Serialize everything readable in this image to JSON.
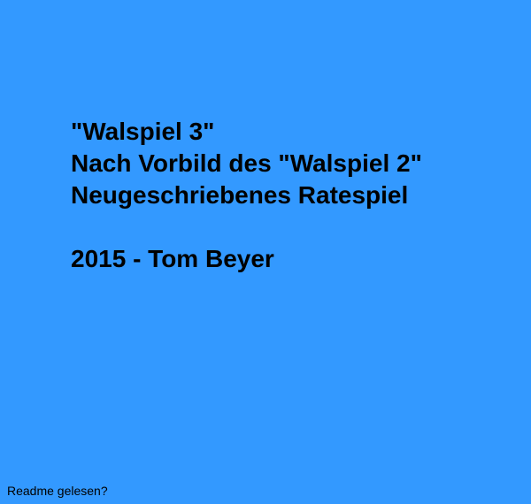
{
  "colors": {
    "background": "#3399ff",
    "text": "#000000"
  },
  "intro": {
    "title": "\"Walspiel 3\"",
    "subtitle": "Nach Vorbild des \"Walspiel 2\"",
    "description": "Neugeschriebenes Ratespiel",
    "credit": "2015 - Tom Beyer"
  },
  "footer": {
    "readme_prompt": "Readme gelesen?"
  }
}
